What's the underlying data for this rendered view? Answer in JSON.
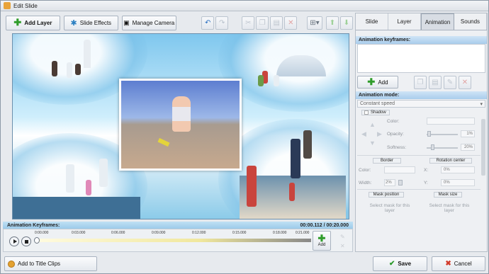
{
  "window": {
    "title": "Edit Slide"
  },
  "toolbar": {
    "add_layer": "Add Layer",
    "slide_effects": "Slide Effects",
    "manage_camera": "Manage Camera"
  },
  "timeline": {
    "header": "Animation Keyframes:",
    "time_readout": "00:00.112 / 00:20.000",
    "ticks": [
      "0:00.000",
      "0:03.000",
      "0:06.000",
      "0:09.000",
      "0:12.000",
      "0:15.000",
      "0:18.000",
      "0:21.000"
    ],
    "add_label": "Add",
    "position_fraction": 0.005
  },
  "tabs": [
    "Slide",
    "Layer",
    "Animation",
    "Sounds"
  ],
  "active_tab": "Animation",
  "panel": {
    "keyframes_header": "Animation keyframes:",
    "add_label": "Add",
    "mode_header": "Animation mode:",
    "mode_value": "Constant speed",
    "shadow": {
      "label": "Shadow",
      "color_label": "Color:",
      "opacity_label": "Opacity:",
      "opacity_value": "1%",
      "softness_label": "Softness:",
      "softness_value": "20%"
    },
    "border": {
      "title": "Border",
      "color_label": "Color:",
      "width_label": "Width:",
      "width_value": "2%"
    },
    "rotation": {
      "title": "Rotation center",
      "x_label": "X:",
      "x_value": "0%",
      "y_label": "Y:",
      "y_value": "0%"
    },
    "mask_position": {
      "title": "Mask position",
      "text": "Select mask for this layer"
    },
    "mask_size": {
      "title": "Mask size",
      "text": "Select mask for this layer"
    }
  },
  "bottom": {
    "add_title_clips": "Add to Title Clips",
    "save": "Save",
    "cancel": "Cancel"
  }
}
